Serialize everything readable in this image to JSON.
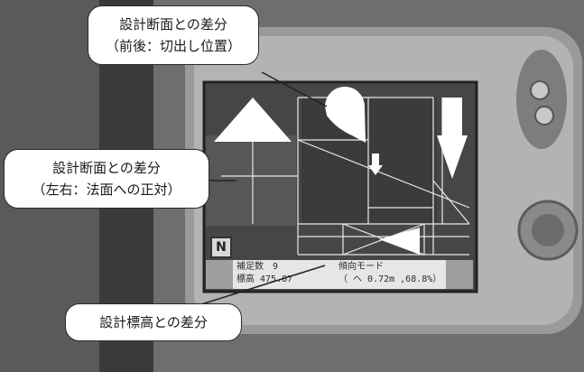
{
  "callouts": {
    "top_line1": "設計断面との差分",
    "top_line2": "（前後：切出し位置）",
    "left_line1": "設計断面との差分",
    "left_line2": "（左右：法面への正対）",
    "bottom": "設計標高との差分"
  },
  "screen_status": {
    "line1": "補足数　9",
    "line2": "標高 475.87",
    "mode": "傾向モード",
    "reading": "（ ヘ 0.72m ,68.8%）",
    "n_label": "N"
  },
  "colors": {
    "screen_bg": "#4a4a4a",
    "white_arrow": "#ffffff",
    "bezel": "#9a9a9a"
  }
}
